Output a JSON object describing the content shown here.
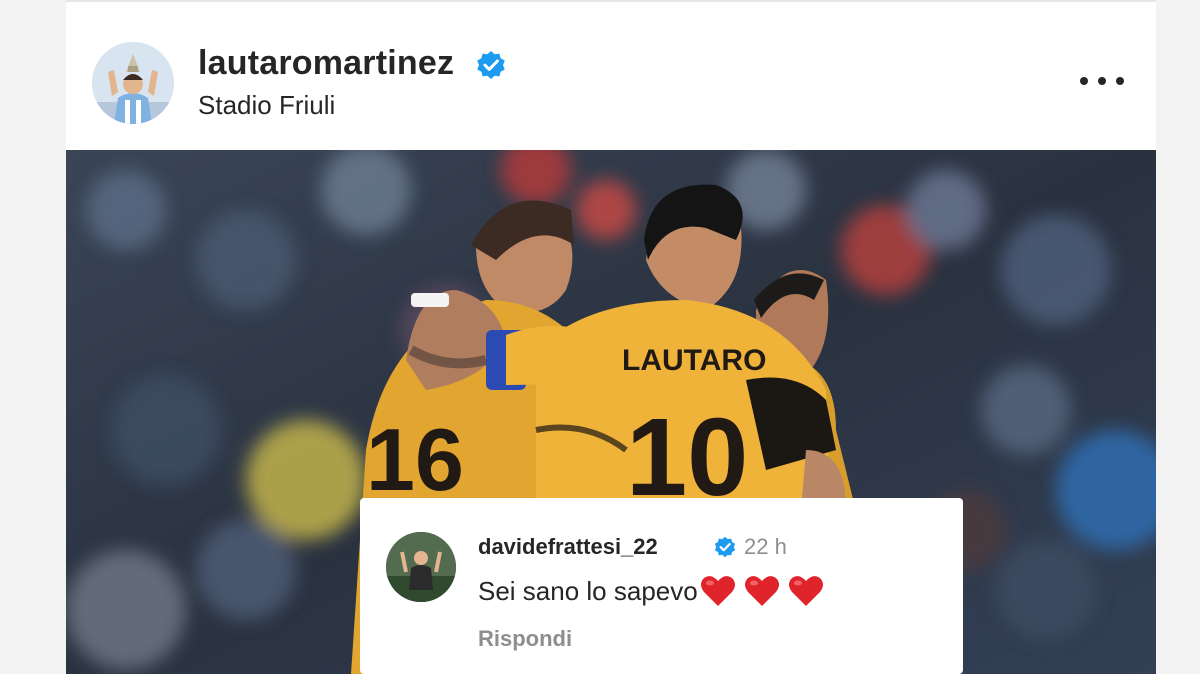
{
  "post": {
    "username": "lautaromartinez",
    "location": "Stadio Friuli",
    "photo_jersey_name": "LAUTARO",
    "photo_number_right": "10",
    "photo_number_left": "16"
  },
  "comment": {
    "username": "davidefrattesi_22",
    "time": "22 h",
    "text": "Sei sano lo sapevo",
    "reply_label": "Rispondi"
  },
  "colors": {
    "verified": "#1d9bf0",
    "heart": "#e0242c",
    "jersey": "#e9a931"
  },
  "icons": [
    "verified-badge-icon",
    "more-options-icon",
    "heart-emoji-icon"
  ]
}
